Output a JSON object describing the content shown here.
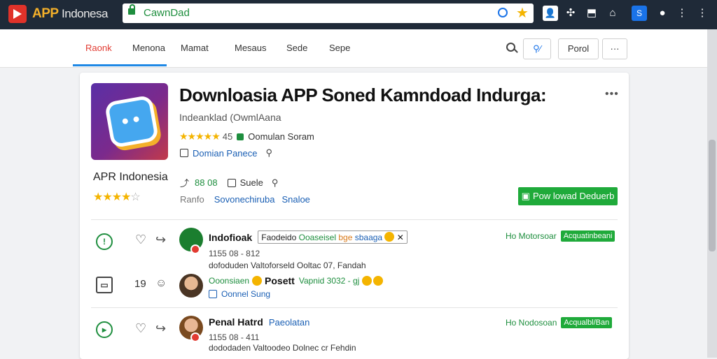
{
  "browser": {
    "brand_main": "APP",
    "brand_rest": "Indonesa",
    "url": "CawnDad",
    "extensions": [
      "ext-a",
      "ext-b",
      "ext-c",
      "ext-d",
      "ext-e",
      "ext-f",
      "ext-menu"
    ]
  },
  "nav": {
    "items": [
      "Raonk",
      "Menona",
      "Mamat",
      "Mesaus",
      "Sede",
      "Sepe"
    ],
    "active": "Raonk",
    "buttons": {
      "filter": "",
      "portal": "Porol",
      "more": "···"
    }
  },
  "app": {
    "title": "Downloasia APP Soned Kamndoad Indurga:",
    "subtitle": "Indeanklad (OwmlAana",
    "rating_text": "45",
    "category": "Oomulan Soram",
    "link1": "Domian Panece",
    "label": "APR Indonesia",
    "stat1": "88 08",
    "stat2": "Suele",
    "line_a": "Ranfo",
    "line_b": "Sovonechiruba",
    "line_c": "Snaloe",
    "download_label": "Pow lowad Deduerb"
  },
  "reviews": [
    {
      "name": "Indofioak",
      "tag": "Faodeido",
      "tag_green": "Ooaseisel",
      "tag_orange": "bge",
      "tag_blue": "sbaaga",
      "date": "1155 08 - 812",
      "text": "dofoduden Valtoforseld Ooltac 07, Fandah",
      "moderator": "Ho Motorsoar",
      "pill": "Acquatinbeani",
      "count": ""
    },
    {
      "name": "Posett",
      "line1_prefix": "Ooonsiaen",
      "line1_rest": "Vapnid 3032 - gj",
      "line2": "Oonnel Sung",
      "count": "19"
    },
    {
      "name": "Penal Hatrd",
      "name_blue": "Paeolatan",
      "date": "1155 08 - 411",
      "text": "dododaden Valtoodeo Dolnec cr Fehdin",
      "moderator": "Ho Nodosoan",
      "pill": "Acqualbl/Ban"
    }
  ]
}
